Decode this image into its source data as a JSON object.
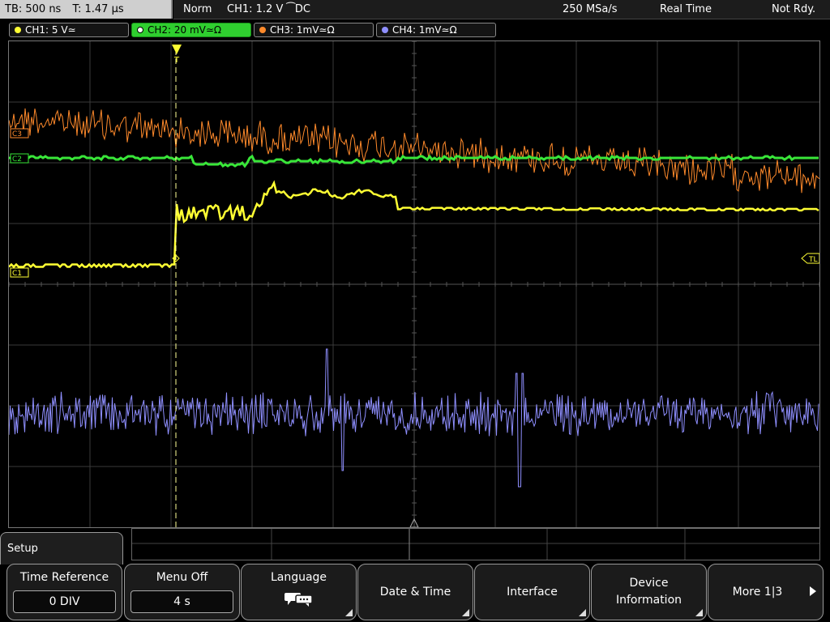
{
  "status_bar": {
    "timebase": "TB: 500 ns",
    "trigger_time": "T: 1.47 µs",
    "mode": "Norm",
    "trigger": "CH1: 1.2 V ⁀DC",
    "sample_rate": "250 MSa/s",
    "acq_mode": "Real Time",
    "state": "Not Rdy."
  },
  "channels": [
    {
      "label": "CH1: 5 V≃",
      "color": "#ffff33",
      "active": false
    },
    {
      "label": "CH2: 20 mV≃Ω",
      "color": "#39e639",
      "active": true
    },
    {
      "label": "CH3: 1mV≃Ω",
      "color": "#ff8a2b",
      "active": false
    },
    {
      "label": "CH4: 1mV≃Ω",
      "color": "#8f8fff",
      "active": false
    }
  ],
  "markers": {
    "c3": "C3",
    "c2": "C2",
    "c1": "C1",
    "tl": "TL",
    "trigger_top": "T"
  },
  "menu": {
    "title": "Setup",
    "buttons": [
      {
        "label": "Time Reference",
        "value": "0 DIV"
      },
      {
        "label": "Menu Off",
        "value": "4 s"
      },
      {
        "label": "Language",
        "icon": "speech-bubble-icon"
      },
      {
        "label": "Date & Time"
      },
      {
        "label": "Interface"
      },
      {
        "label": "Device",
        "label2": "Information"
      },
      {
        "label": "More 1|3"
      }
    ]
  },
  "colors": {
    "ch1": "#ffff33",
    "ch2": "#39e639",
    "ch3": "#ff8a2b",
    "ch4": "#8f8fff"
  }
}
